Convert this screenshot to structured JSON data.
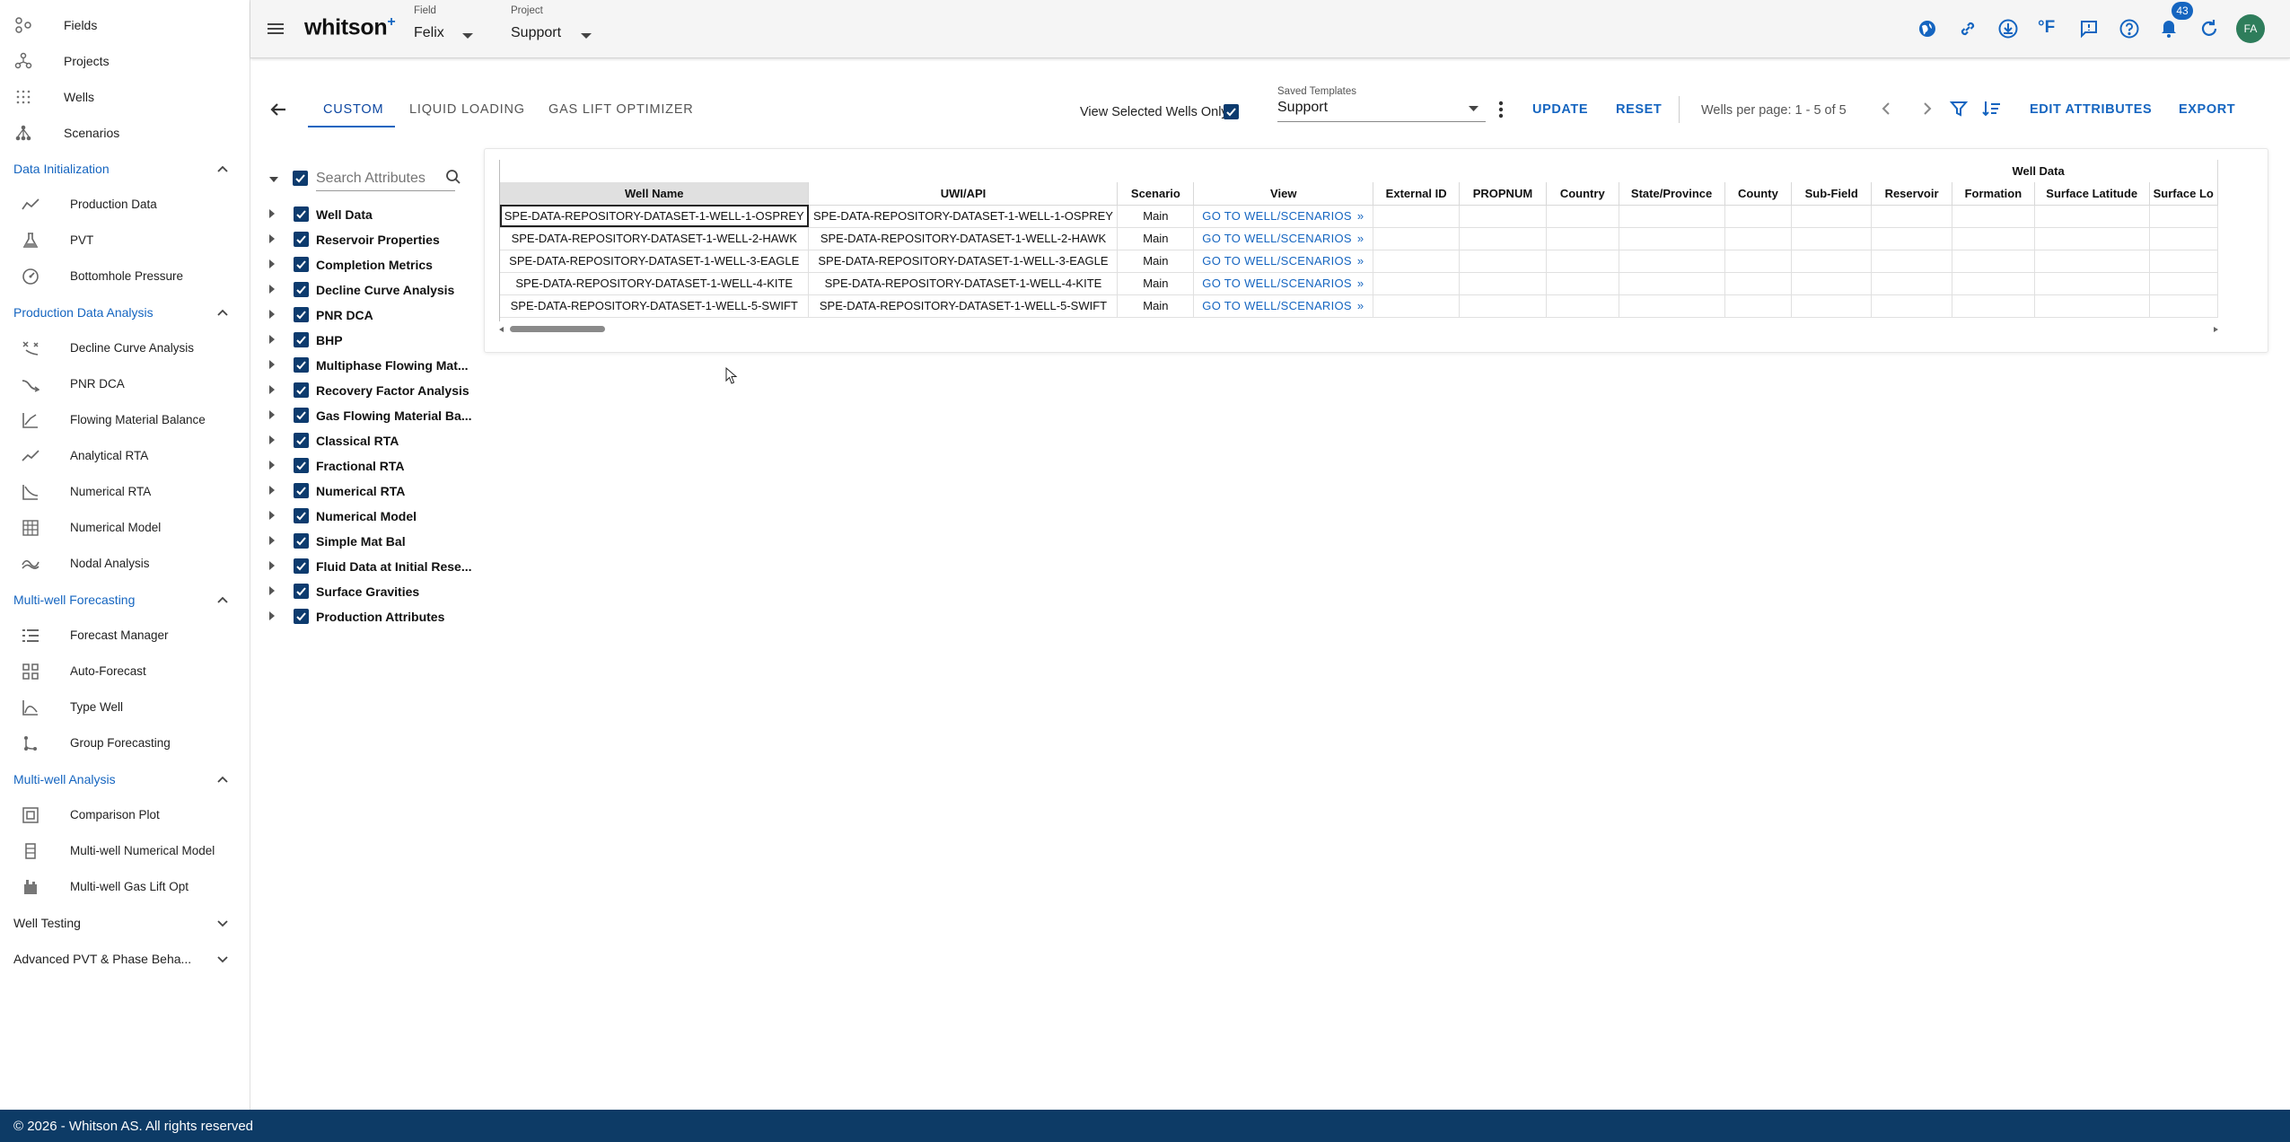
{
  "sidebar": {
    "top_items": [
      {
        "label": "Fields",
        "icon": "fields-icon"
      },
      {
        "label": "Projects",
        "icon": "projects-icon"
      },
      {
        "label": "Wells",
        "icon": "wells-icon"
      },
      {
        "label": "Scenarios",
        "icon": "scenarios-icon"
      }
    ],
    "sections": [
      {
        "title": "Data Initialization",
        "expanded": true,
        "items": [
          "Production Data",
          "PVT",
          "Bottomhole Pressure"
        ]
      },
      {
        "title": "Production Data Analysis",
        "expanded": true,
        "items": [
          "Decline Curve Analysis",
          "PNR DCA",
          "Flowing Material Balance",
          "Analytical RTA",
          "Numerical RTA",
          "Numerical Model",
          "Nodal Analysis"
        ]
      },
      {
        "title": "Multi-well Forecasting",
        "expanded": true,
        "items": [
          "Forecast Manager",
          "Auto-Forecast",
          "Type Well",
          "Group Forecasting"
        ]
      },
      {
        "title": "Multi-well Analysis",
        "expanded": true,
        "items": [
          "Comparison Plot",
          "Multi-well Numerical Model",
          "Multi-well Gas Lift Opt"
        ]
      },
      {
        "title": "Well Testing",
        "expanded": false,
        "items": []
      },
      {
        "title": "Advanced PVT & Phase Beha...",
        "expanded": false,
        "items": []
      }
    ]
  },
  "header": {
    "logo": "whitson",
    "logo_plus": "+",
    "field_label": "Field",
    "field_value": "Felix",
    "project_label": "Project",
    "project_value": "Support",
    "notification_count": "43",
    "avatar_initials": "FA",
    "temp_unit": "°F"
  },
  "toolbar": {
    "tabs": [
      "CUSTOM",
      "LIQUID LOADING",
      "GAS LIFT OPTIMIZER"
    ],
    "active_tab": "CUSTOM",
    "view_selected_label": "View Selected Wells Only",
    "saved_templates_label": "Saved Templates",
    "saved_templates_value": "Support",
    "update_label": "UPDATE",
    "reset_label": "RESET",
    "wells_per_page": "Wells per page: 1 - 5 of 5",
    "edit_attributes_label": "EDIT ATTRIBUTES",
    "export_label": "EXPORT"
  },
  "attributes": {
    "search_placeholder": "Search Attributes",
    "groups": [
      "Well Data",
      "Reservoir Properties",
      "Completion Metrics",
      "Decline Curve Analysis",
      "PNR DCA",
      "BHP",
      "Multiphase Flowing Mat...",
      "Recovery Factor Analysis",
      "Gas Flowing Material Ba...",
      "Classical RTA",
      "Fractional RTA",
      "Numerical RTA",
      "Numerical Model",
      "Simple Mat Bal",
      "Fluid Data at Initial Rese...",
      "Surface Gravities",
      "Production Attributes"
    ]
  },
  "grid": {
    "group_header": "Well Data",
    "columns": [
      "Well Name",
      "UWI/API",
      "Scenario",
      "View",
      "External ID",
      "PROPNUM",
      "Country",
      "State/Province",
      "County",
      "Sub-Field",
      "Reservoir",
      "Formation",
      "Surface Latitude",
      "Surface Lo"
    ],
    "link_text": "GO TO WELL/SCENARIOS",
    "rows": [
      {
        "well_name": "SPE-DATA-REPOSITORY-DATASET-1-WELL-1-OSPREY",
        "uwi": "SPE-DATA-REPOSITORY-DATASET-1-WELL-1-OSPREY",
        "scenario": "Main"
      },
      {
        "well_name": "SPE-DATA-REPOSITORY-DATASET-1-WELL-2-HAWK",
        "uwi": "SPE-DATA-REPOSITORY-DATASET-1-WELL-2-HAWK",
        "scenario": "Main"
      },
      {
        "well_name": "SPE-DATA-REPOSITORY-DATASET-1-WELL-3-EAGLE",
        "uwi": "SPE-DATA-REPOSITORY-DATASET-1-WELL-3-EAGLE",
        "scenario": "Main"
      },
      {
        "well_name": "SPE-DATA-REPOSITORY-DATASET-1-WELL-4-KITE",
        "uwi": "SPE-DATA-REPOSITORY-DATASET-1-WELL-4-KITE",
        "scenario": "Main"
      },
      {
        "well_name": "SPE-DATA-REPOSITORY-DATASET-1-WELL-5-SWIFT",
        "uwi": "SPE-DATA-REPOSITORY-DATASET-1-WELL-5-SWIFT",
        "scenario": "Main"
      }
    ]
  },
  "footer": {
    "text": "© 2026 - Whitson AS. All rights reserved"
  },
  "colors": {
    "accent": "#1565c0",
    "footer": "#0d3b66",
    "avatar": "#2e7d5b",
    "badge": "#1565c0"
  }
}
